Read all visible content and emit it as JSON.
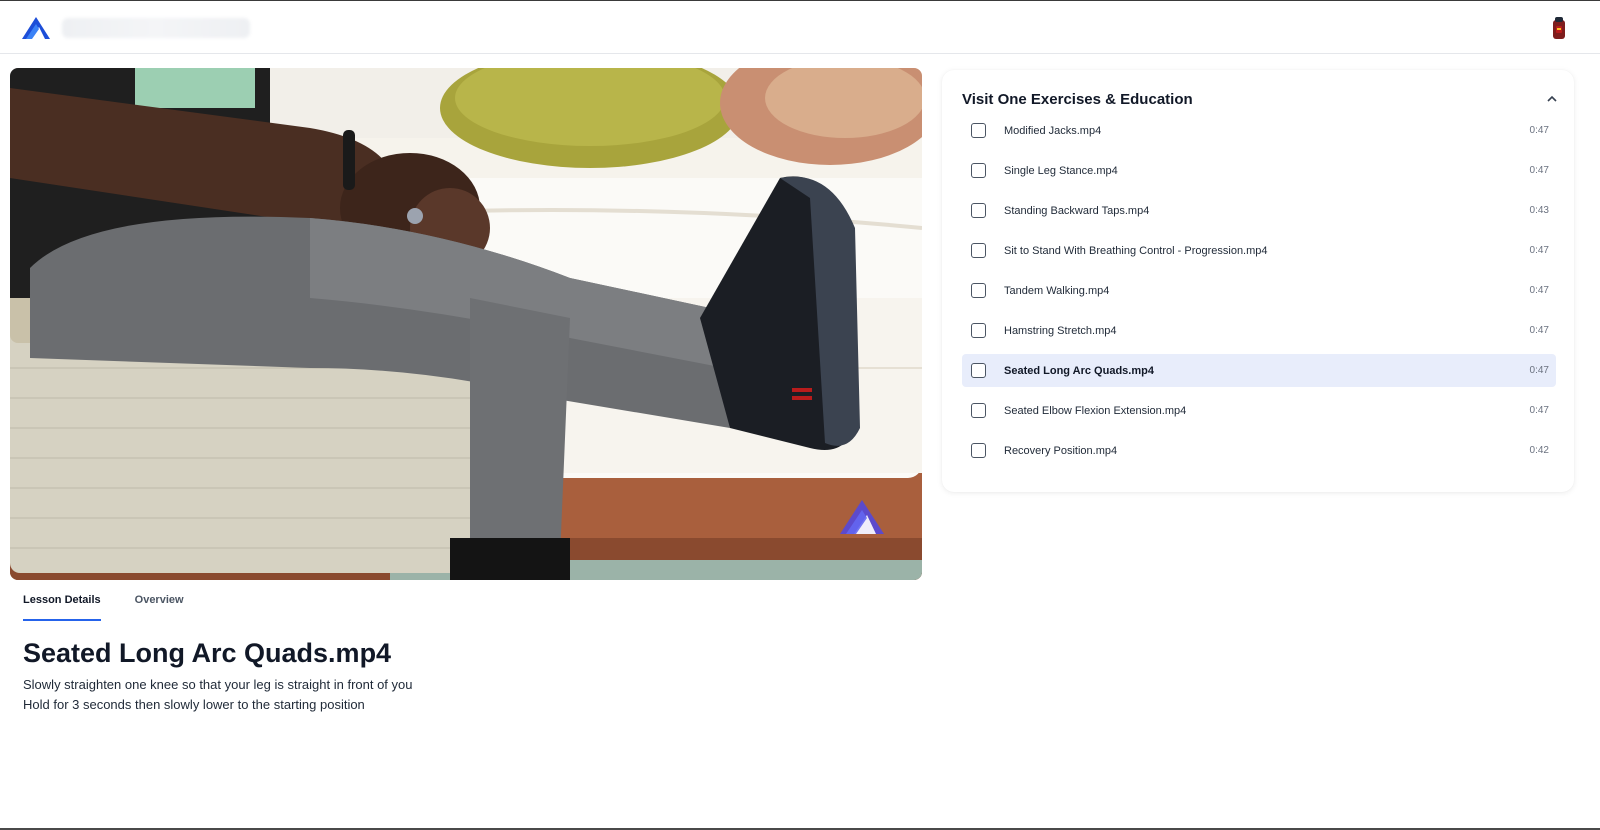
{
  "header": {
    "logo_icon": "brand-logo-icon",
    "avatar_icon": "user-avatar-icon"
  },
  "video": {
    "watermark_icon": "brand-logo-icon"
  },
  "tabs": [
    {
      "label": "Lesson Details",
      "active": true
    },
    {
      "label": "Overview",
      "active": false
    }
  ],
  "lesson": {
    "title": "Seated Long Arc Quads.mp4",
    "description_lines": [
      "Slowly straighten one knee so that your leg is straight in front of you",
      "Hold for 3 seconds then slowly lower to the starting position"
    ]
  },
  "playlist": {
    "title": "Visit One Exercises & Education",
    "collapse_icon": "chevron-up-icon",
    "items": [
      {
        "label": "Modified Jacks.mp4",
        "duration": "0:47"
      },
      {
        "label": "Single Leg Stance.mp4",
        "duration": "0:47"
      },
      {
        "label": "Standing Backward Taps.mp4",
        "duration": "0:43"
      },
      {
        "label": "Sit to Stand With Breathing Control - Progression.mp4",
        "duration": "0:47"
      },
      {
        "label": "Tandem Walking.mp4",
        "duration": "0:47"
      },
      {
        "label": "Hamstring Stretch.mp4",
        "duration": "0:47"
      },
      {
        "label": "Seated Long Arc Quads.mp4",
        "duration": "0:47",
        "active": true
      },
      {
        "label": "Seated Elbow Flexion Extension.mp4",
        "duration": "0:47"
      },
      {
        "label": "Recovery Position.mp4",
        "duration": "0:42"
      }
    ]
  },
  "colors": {
    "accent": "#2563eb",
    "active_row_bg": "#e8edfb"
  }
}
